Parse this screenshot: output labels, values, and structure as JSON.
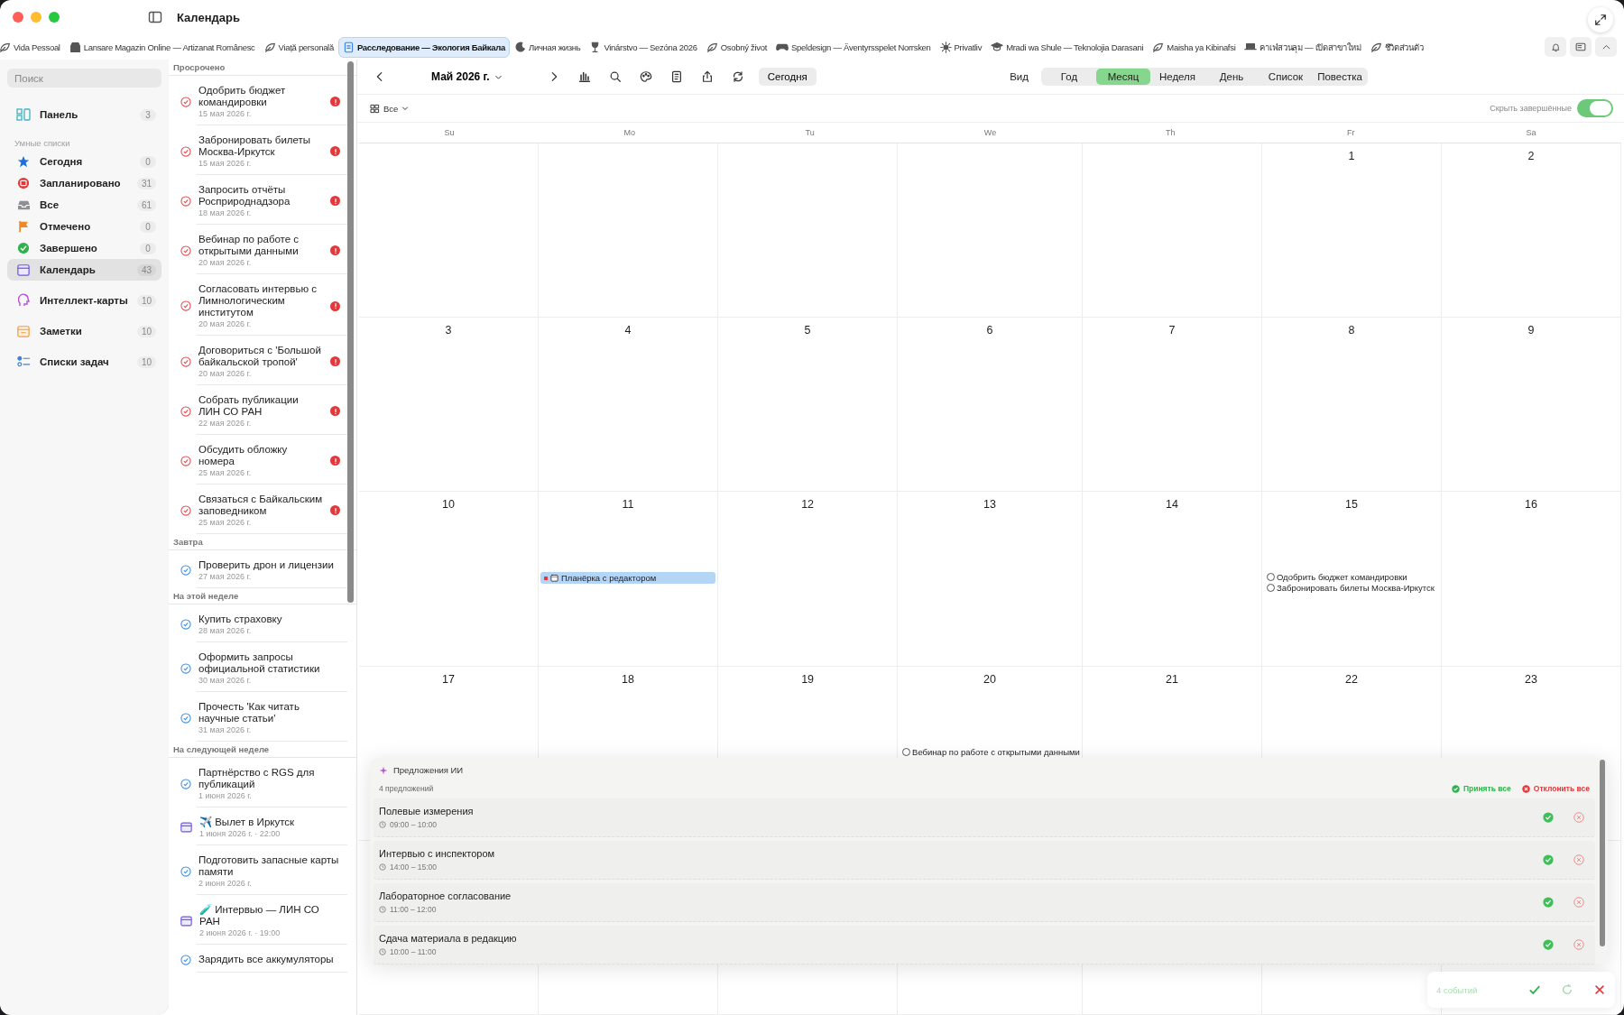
{
  "window": {
    "title": "Календарь"
  },
  "tabs": [
    {
      "label": "Vida Pessoal",
      "kind": "leaf",
      "selected": false
    },
    {
      "label": "Lansare Magazin Online — Artizanat Românesc",
      "kind": "store",
      "selected": false
    },
    {
      "label": "Viață personală",
      "kind": "leaf",
      "selected": false
    },
    {
      "label": "Расследование — Экология Байкала",
      "kind": "doc",
      "selected": true
    },
    {
      "label": "Личная жизнь",
      "kind": "moon",
      "selected": false
    },
    {
      "label": "Vinárstvo — Sezóna 2026",
      "kind": "glass",
      "selected": false
    },
    {
      "label": "Osobný život",
      "kind": "leaf",
      "selected": false
    },
    {
      "label": "Speldesign — Äventyrsspelet Norrsken",
      "kind": "gamepad",
      "selected": false
    },
    {
      "label": "Privatliv",
      "kind": "sun",
      "selected": false
    },
    {
      "label": "Mradi wa Shule — Teknolojia Darasani",
      "kind": "cap",
      "selected": false
    },
    {
      "label": "Maisha ya Kibinafsi",
      "kind": "leaf",
      "selected": false
    },
    {
      "label": "คาเฟ่สวนลุม — เปิดสาขาใหม่",
      "kind": "hat",
      "selected": false
    },
    {
      "label": "ชีวิตส่วนตัว",
      "kind": "leaf",
      "selected": false
    }
  ],
  "sidebar": {
    "search": {
      "placeholder": "Поиск"
    },
    "groups": [
      {
        "items": [
          {
            "label": "Панель",
            "count": "3",
            "kind": "dashboard",
            "selected": false
          }
        ]
      },
      {
        "heading": "Умные списки",
        "items": [
          {
            "label": "Сегодня",
            "count": "0",
            "kind": "star",
            "selected": false
          },
          {
            "label": "Запланировано",
            "count": "31",
            "kind": "scheduled",
            "selected": false
          },
          {
            "label": "Все",
            "count": "61",
            "kind": "inbox",
            "selected": false
          },
          {
            "label": "Отмечено",
            "count": "0",
            "kind": "flag",
            "selected": false
          },
          {
            "label": "Завершено",
            "count": "0",
            "kind": "done",
            "selected": false
          },
          {
            "label": "Календарь",
            "count": "43",
            "kind": "calendar",
            "selected": true
          }
        ]
      },
      {
        "items": [
          {
            "label": "Интеллект-карты",
            "count": "10",
            "kind": "mind",
            "selected": false
          }
        ]
      },
      {
        "items": [
          {
            "label": "Заметки",
            "count": "10",
            "kind": "notes",
            "selected": false
          }
        ]
      },
      {
        "items": [
          {
            "label": "Списки задач",
            "count": "10",
            "kind": "lists",
            "selected": false
          }
        ]
      }
    ]
  },
  "task_list": {
    "sections": [
      {
        "heading": "Просрочено",
        "items": [
          {
            "kind": "task",
            "title": "Одобрить бюджет командировки",
            "date": "15 мая 2026 г.",
            "overdue": true,
            "important": true
          },
          {
            "kind": "task",
            "title": "Забронировать билеты Москва-Иркутск",
            "date": "15 мая 2026 г.",
            "overdue": true,
            "important": true
          },
          {
            "kind": "task",
            "title": "Запросить отчёты Росприроднадзора",
            "date": "18 мая 2026 г.",
            "overdue": true,
            "important": true
          },
          {
            "kind": "task",
            "title": "Вебинар по работе с открытыми данными",
            "date": "20 мая 2026 г.",
            "overdue": true,
            "important": true
          },
          {
            "kind": "task",
            "title": "Согласовать интервью с Лимнологическим институтом",
            "date": "20 мая 2026 г.",
            "overdue": true,
            "important": true
          },
          {
            "kind": "task",
            "title": "Договориться с 'Большой байкальской тропой'",
            "date": "20 мая 2026 г.",
            "overdue": true,
            "important": true
          },
          {
            "kind": "task",
            "title": "Собрать публикации ЛИН СО РАН",
            "date": "22 мая 2026 г.",
            "overdue": true,
            "important": true
          },
          {
            "kind": "task",
            "title": "Обсудить обложку номера",
            "date": "25 мая 2026 г.",
            "overdue": true,
            "important": true
          },
          {
            "kind": "task",
            "title": "Связаться с Байкальским заповедником",
            "date": "25 мая 2026 г.",
            "overdue": true,
            "important": true
          }
        ]
      },
      {
        "heading": "Завтра",
        "items": [
          {
            "kind": "task",
            "title": "Проверить дрон и лицензии",
            "date": "27 мая 2026 г.",
            "overdue": false,
            "important": false
          }
        ]
      },
      {
        "heading": "На этой неделе",
        "items": [
          {
            "kind": "task",
            "title": "Купить страховку",
            "date": "28 мая 2026 г.",
            "overdue": false,
            "important": false
          },
          {
            "kind": "task",
            "title": "Оформить запросы официальной статистики",
            "date": "30 мая 2026 г.",
            "overdue": false,
            "important": false
          },
          {
            "kind": "task",
            "title": "Прочесть 'Как читать научные статьи'",
            "date": "31 мая 2026 г.",
            "overdue": false,
            "important": false
          }
        ]
      },
      {
        "heading": "На следующей неделе",
        "items": [
          {
            "kind": "task",
            "title": "Партнёрство с RGS для публикаций",
            "date": "1 июня 2026 г.",
            "overdue": false,
            "important": false
          },
          {
            "kind": "event",
            "title": "✈️ Вылет в Иркутск",
            "date": "1 июня 2026 г. · 22:00"
          },
          {
            "kind": "task",
            "title": "Подготовить запасные карты памяти",
            "date": "2 июня 2026 г.",
            "overdue": false,
            "important": false
          },
          {
            "kind": "event",
            "title": "🧪 Интервью — ЛИН СО РАН",
            "date": "2 июня 2026 г. · 19:00"
          },
          {
            "kind": "task",
            "title": "Зарядить все аккумуляторы",
            "overdue": false,
            "important": false
          }
        ]
      }
    ]
  },
  "toolbar": {
    "month": "Май 2026 г.",
    "today_button": "Сегодня",
    "view_label": "Вид",
    "views": [
      {
        "label": "Год",
        "selected": false
      },
      {
        "label": "Месяц",
        "selected": true
      },
      {
        "label": "Неделя",
        "selected": false
      },
      {
        "label": "День",
        "selected": false
      },
      {
        "label": "Список",
        "selected": false
      },
      {
        "label": "Повестка",
        "selected": false
      }
    ]
  },
  "filter": {
    "label": "Все",
    "hide_completed": {
      "label": "Скрыть завершённые",
      "on": true
    }
  },
  "calendar": {
    "weekdays": [
      "Su",
      "Mo",
      "Tu",
      "We",
      "Th",
      "Fr",
      "Sa"
    ],
    "weeks": [
      [
        {
          "day": "1"
        },
        {
          "day": "2"
        }
      ],
      [
        {
          "day": "3"
        },
        {
          "day": "4"
        },
        {
          "day": "5"
        },
        {
          "day": "6"
        },
        {
          "day": "7"
        },
        {
          "day": "8"
        },
        {
          "day": "9"
        }
      ],
      [
        {
          "day": "10"
        },
        {
          "day": "11",
          "entries": [
            {
              "kind": "event",
              "title": "Планёрка с редактором"
            }
          ]
        },
        {
          "day": "12"
        },
        {
          "day": "13"
        },
        {
          "day": "14"
        },
        {
          "day": "15",
          "entries": [
            {
              "kind": "task",
              "title": "Одобрить бюджет командировки"
            },
            {
              "kind": "task",
              "title": "Забронировать билеты Москва-Иркутск"
            }
          ]
        },
        {
          "day": "16"
        }
      ],
      [
        {
          "day": "17"
        },
        {
          "day": "18"
        },
        {
          "day": "19"
        },
        {
          "day": "20",
          "entries": [
            {
              "kind": "task",
              "title": "Вебинар по работе с открытыми данными"
            }
          ]
        },
        {
          "day": "21"
        },
        {
          "day": "22"
        },
        {
          "day": "23"
        }
      ]
    ]
  },
  "ai_suggestions": {
    "title": "Предложения ИИ",
    "count": "4 предложений",
    "accept_all": "Принять все",
    "reject_all": "Отклонить все",
    "items": [
      {
        "title": "Полевые измерения",
        "time": "09:00 – 10:00"
      },
      {
        "title": "Интервью с инспектором",
        "time": "14:00 – 15:00"
      },
      {
        "title": "Лабораторное согласование",
        "time": "11:00 – 12:00"
      },
      {
        "title": "Сдача материала в редакцию",
        "time": "10:00 – 11:00"
      }
    ]
  },
  "floating_bar": {
    "count": "4 событий"
  }
}
